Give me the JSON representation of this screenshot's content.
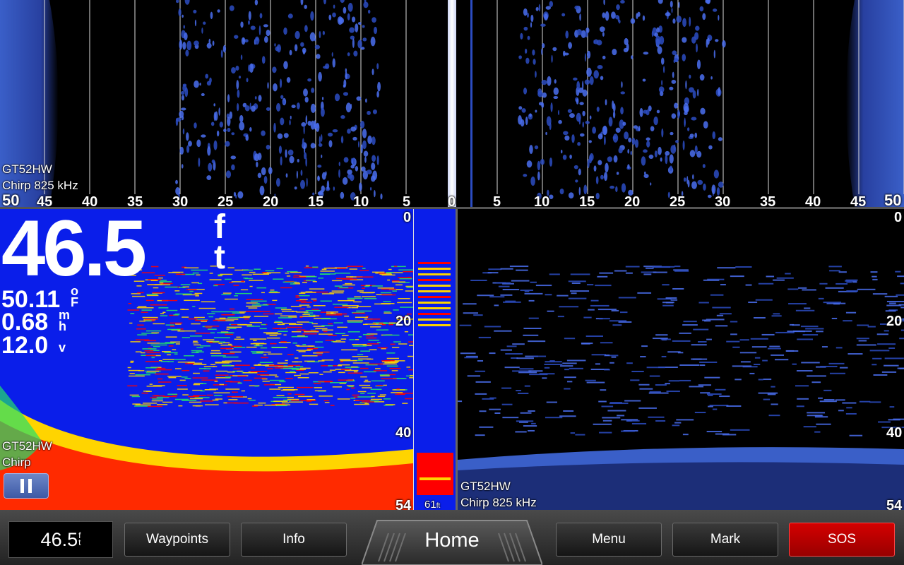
{
  "sidevu": {
    "source_label": "GT52HW",
    "freq_label": "Chirp 825 kHz",
    "left_scale": [
      "50",
      "45",
      "40",
      "35",
      "30",
      "25",
      "20",
      "15",
      "10",
      "5",
      "0"
    ],
    "right_scale": [
      "5",
      "10",
      "15",
      "20",
      "25",
      "30",
      "35",
      "40",
      "45",
      "50"
    ]
  },
  "traditional": {
    "depth_value": "46.5",
    "depth_unit_top": "f",
    "depth_unit_bottom": "t",
    "temp_value": "50.11",
    "temp_unit_top": "o",
    "temp_unit_bottom": "F",
    "speed_value": "0.68",
    "speed_unit_top": "m",
    "speed_unit_bottom": "h",
    "voltage_value": "12.0",
    "voltage_unit": "v",
    "scale": [
      "0",
      "20",
      "40",
      "54"
    ],
    "source_label": "GT52HW",
    "mode_label": "Chirp",
    "flasher_depth": "61",
    "flasher_unit": "ft"
  },
  "downvu": {
    "source_label": "GT52HW",
    "freq_label": "Chirp 825 kHz",
    "scale": [
      "0",
      "20",
      "40",
      "54"
    ]
  },
  "bottombar": {
    "depth_value": "46.5",
    "depth_unit_top": "f",
    "depth_unit_bottom": "t",
    "waypoints": "Waypoints",
    "info": "Info",
    "home": "Home",
    "menu": "Menu",
    "mark": "Mark",
    "sos": "SOS"
  },
  "colors": {
    "sonar_bg_blue": "#0a1eea",
    "sos_red": "#d40000",
    "return_strong": "#ff0000",
    "return_medium": "#ffd400",
    "return_weak": "#22e06a"
  },
  "icons": {
    "pause": "pause-icon"
  }
}
